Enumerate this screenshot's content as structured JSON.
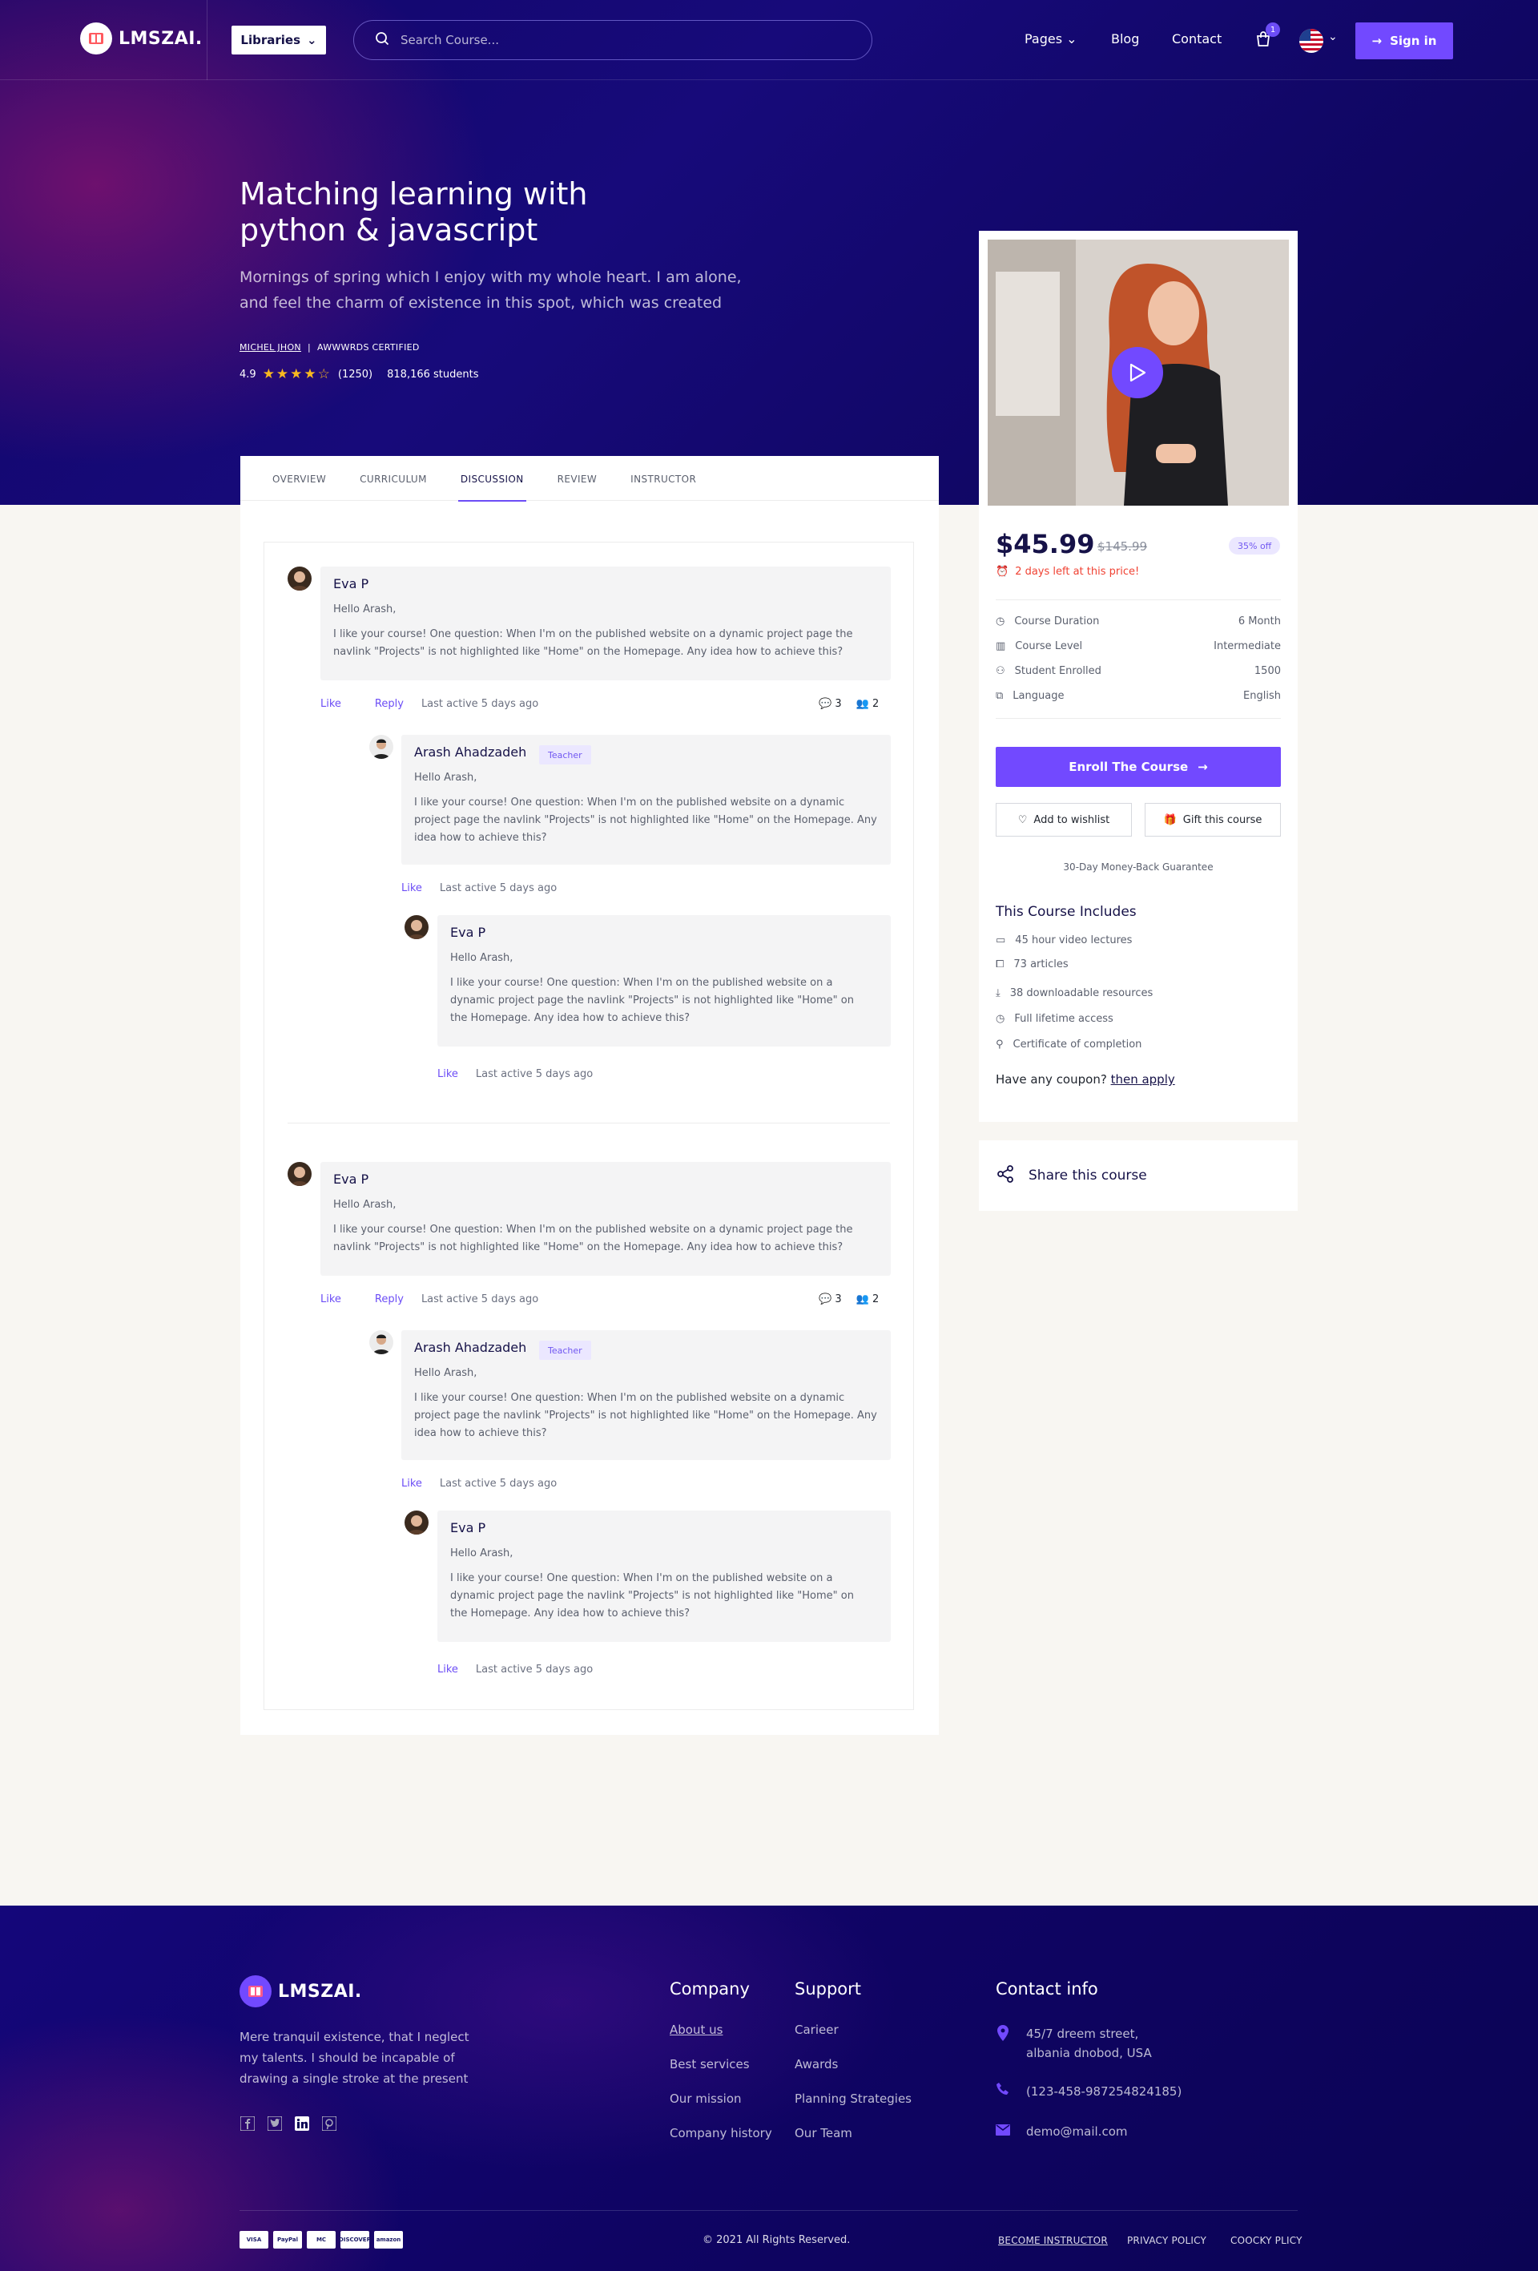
{
  "brand": {
    "name": "LMSZAI."
  },
  "nav": {
    "libraries_label": "Libraries",
    "search_placeholder": "Search Course...",
    "links": [
      "Pages",
      "Blog",
      "Contact"
    ],
    "cart_count": "1",
    "signin_label": "Sign in"
  },
  "hero": {
    "title": "Matching learning with python & javascript",
    "description": "Mornings of spring which I enjoy with my whole heart. I am alone, and feel the charm of existence in this spot, which was created",
    "author": "MICHEL JHON",
    "certification": "AWWWRDS CERTIFIED",
    "rating": "4.9",
    "reviews": "(1250)",
    "students": "818,166 students"
  },
  "tabs": [
    "OVERVIEW",
    "CURRICULUM",
    "DISCUSSION",
    "REVIEW",
    "INSTRUCTOR"
  ],
  "active_tab": "DISCUSSION",
  "threads": [
    {
      "name": "Eva P",
      "greeting": "Hello Arash,",
      "text": "I like your course! One question: When I'm on the published website on a dynamic project page the navlink \"Projects\" is not highlighted like \"Home\" on the Homepage. Any idea how to achieve this?",
      "like": "Like",
      "reply": "Reply",
      "last_active": "Last active 5 days ago",
      "comments": "3",
      "participants": "2",
      "reply1": {
        "name": "Arash Ahadzadeh",
        "badge": "Teacher",
        "greeting": "Hello Arash,",
        "text": "I like your course! One question: When I'm on the published website on a dynamic project page the navlink \"Projects\" is not highlighted like \"Home\" on the Homepage. Any idea how to achieve this?",
        "like": "Like",
        "last_active": "Last active 5 days ago"
      },
      "reply2": {
        "name": "Eva P",
        "greeting": "Hello Arash,",
        "text": "I like your course! One question: When I'm on the published website on a dynamic project page the navlink \"Projects\" is not highlighted like \"Home\" on the Homepage. Any idea how to achieve this?",
        "like": "Like",
        "last_active": "Last active 5 days ago"
      }
    },
    {
      "name": "Eva P",
      "greeting": "Hello Arash,",
      "text": "I like your course! One question: When I'm on the published website on a dynamic project page the navlink \"Projects\" is not highlighted like \"Home\" on the Homepage. Any idea how to achieve this?",
      "like": "Like",
      "reply": "Reply",
      "last_active": "Last active 5 days ago",
      "comments": "3",
      "participants": "2",
      "reply1": {
        "name": "Arash Ahadzadeh",
        "badge": "Teacher",
        "greeting": "Hello Arash,",
        "text": "I like your course! One question: When I'm on the published website on a dynamic project page the navlink \"Projects\" is not highlighted like \"Home\" on the Homepage. Any idea how to achieve this?",
        "like": "Like",
        "last_active": "Last active 5 days ago"
      },
      "reply2": {
        "name": "Eva P",
        "greeting": "Hello Arash,",
        "text": "I like your course! One question: When I'm on the published website on a dynamic project page the navlink \"Projects\" is not highlighted like \"Home\" on the Homepage. Any idea how to achieve this?",
        "like": "Like",
        "last_active": "Last active 5 days ago"
      }
    }
  ],
  "course": {
    "price": "$45.99",
    "old_price": "$145.99",
    "discount": "35% off",
    "deadline": "2 days left at this price!",
    "specs": [
      {
        "label": "Course Duration",
        "value": "6 Month",
        "icon": "clock-icon"
      },
      {
        "label": "Course Level",
        "value": "Intermediate",
        "icon": "level-icon"
      },
      {
        "label": "Student Enrolled",
        "value": "1500",
        "icon": "users-icon"
      },
      {
        "label": "Language",
        "value": "English",
        "icon": "language-icon"
      }
    ],
    "enroll_label": "Enroll The Course",
    "wishlist_label": "Add to wishlist",
    "gift_label": "Gift this course",
    "guarantee": "30-Day Money-Back Guarantee",
    "includes_title": "This Course Includes",
    "includes": [
      {
        "text": "45 hour video lectures",
        "icon": "video-icon"
      },
      {
        "text": "73 articles",
        "icon": "book-icon"
      },
      {
        "text": "38 downloadable resources",
        "icon": "download-icon"
      },
      {
        "text": "Full lifetime access",
        "icon": "clock-icon"
      },
      {
        "text": "Certificate of completion",
        "icon": "certificate-icon"
      }
    ],
    "coupon_text": "Have any coupon?",
    "coupon_link": "then apply",
    "share_label": "Share this course"
  },
  "footer": {
    "brand": "LMSZAI.",
    "description": "Mere tranquil existence, that I neglect my talents. I should be incapable of drawing a single stroke at the present",
    "company_title": "Company",
    "company_links": [
      "About us",
      "Best services",
      "Our mission",
      "Company history"
    ],
    "support_title": "Support",
    "support_links": [
      "Carieer",
      "Awards",
      "Planning Strategies",
      "Our Team"
    ],
    "contact_title": "Contact info",
    "address": "45/7 dreem street, albania dnobod, USA",
    "phone": "(123-458-987254824185)",
    "email": "demo@mail.com",
    "payments": [
      "VISA",
      "PayPal",
      "MC",
      "DISCOVER",
      "amazon"
    ],
    "copyright": "© 2021  All Rights Reserved.",
    "bottom_links": [
      "BECOME INSTRUCTOR",
      "PRIVACY POLICY",
      "COOCKY PLICY"
    ]
  }
}
